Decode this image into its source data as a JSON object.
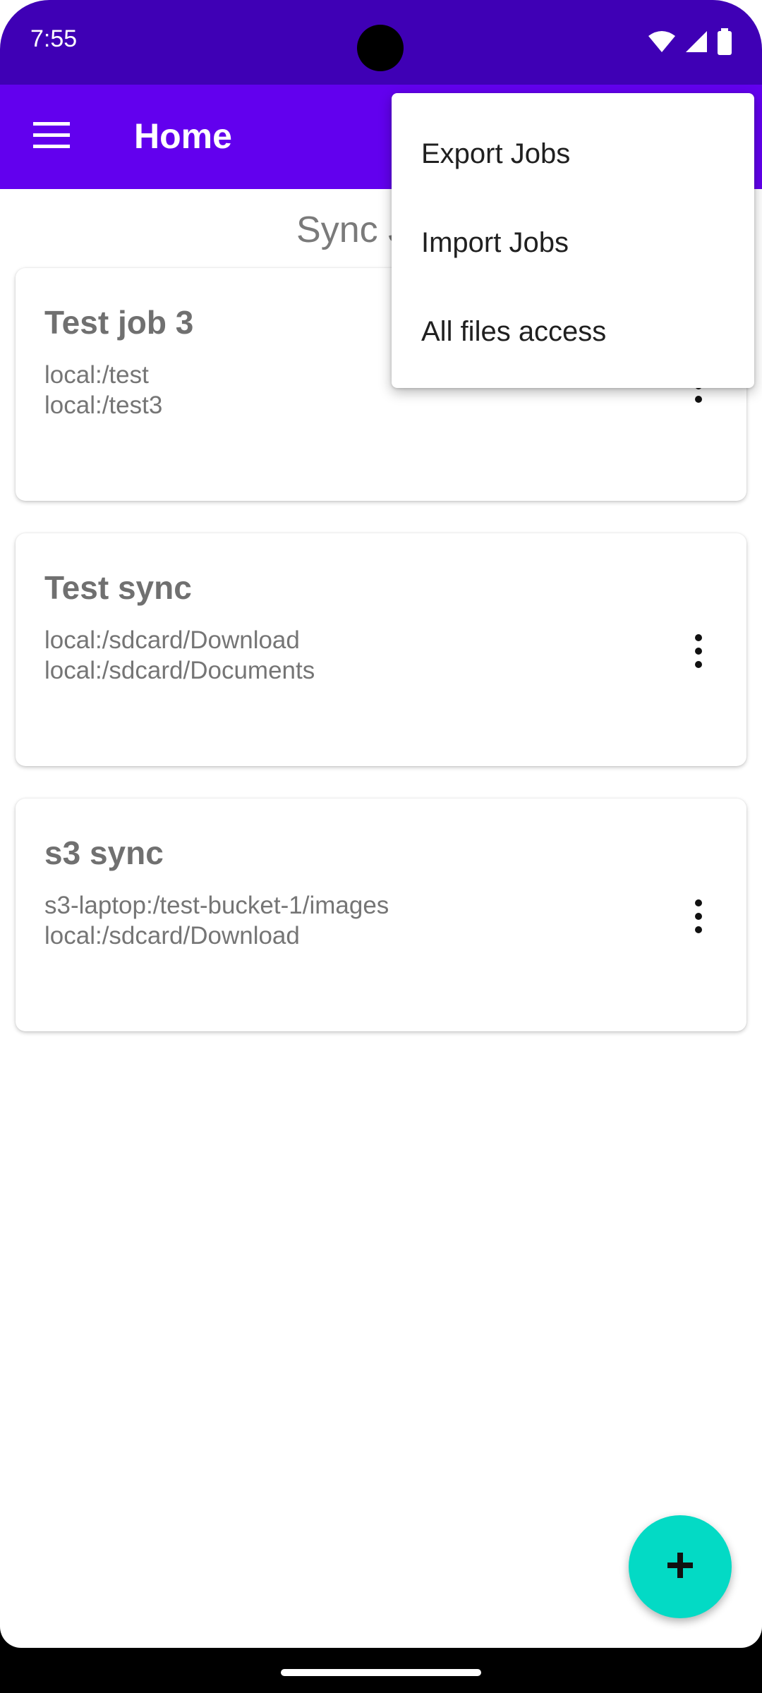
{
  "status_bar": {
    "time": "7:55",
    "icons": [
      "wifi-icon",
      "signal-icon",
      "battery-icon"
    ]
  },
  "app_bar": {
    "title": "Home",
    "nav_icon": "menu-icon",
    "background": "#6200ee"
  },
  "main": {
    "section_title": "Sync Jobs"
  },
  "jobs": [
    {
      "name": "Test job 3",
      "source": "local:/test",
      "destination": "local:/test3"
    },
    {
      "name": "Test sync",
      "source": "local:/sdcard/Download",
      "destination": "local:/sdcard/Documents"
    },
    {
      "name": "s3 sync",
      "source": "s3-laptop:/test-bucket-1/images",
      "destination": "local:/sdcard/Download"
    }
  ],
  "overflow_menu": {
    "items": [
      {
        "label": "Export Jobs"
      },
      {
        "label": "Import Jobs"
      },
      {
        "label": "All files access"
      }
    ]
  },
  "fab": {
    "icon": "plus-icon",
    "color": "#03dac5"
  },
  "colors": {
    "status_bar": "#3f00b5",
    "primary": "#6200ee",
    "accent": "#03dac5"
  }
}
